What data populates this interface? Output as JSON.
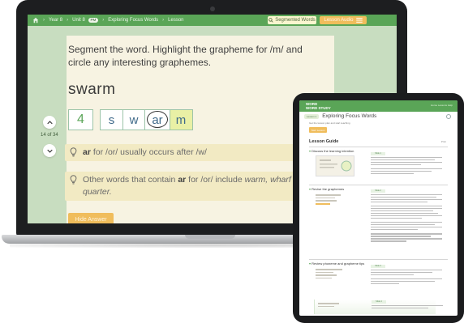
{
  "laptop": {
    "breadcrumb": {
      "items": [
        "Year 8",
        "Unit 8",
        "Exploring Focus Words",
        "Lesson"
      ],
      "unit_badge": "PM"
    },
    "top_pills": {
      "segmented_words": "Segmented Words",
      "lesson_audio": "Lesson Audio"
    },
    "page_count": "14 of 34",
    "instruction": "Segment the word. Highlight the grapheme for /m/ and circle any interesting graphemes.",
    "word": "swarm",
    "phoneme_count": "4",
    "graphemes": [
      {
        "text": "s",
        "circled": false,
        "highlighted": false
      },
      {
        "text": "w",
        "circled": false,
        "highlighted": false
      },
      {
        "text": "ar",
        "circled": true,
        "highlighted": false
      },
      {
        "text": "m",
        "circled": false,
        "highlighted": true
      }
    ],
    "tips": [
      {
        "bold": "ar",
        "text": " for /or/ usually occurs after /w/",
        "italic": ""
      },
      {
        "prefix": "Other words that contain ",
        "bold": "ar",
        "text": " for /or/ include ",
        "italic": "warm, wharf a quarter."
      }
    ],
    "hide_answer_label": "Hide Answer",
    "colors": {
      "accent_green": "#5aa557",
      "accent_orange": "#f0bd5c",
      "panel": "#f7f3e2",
      "tip_bg": "#f2eac3"
    }
  },
  "tablet": {
    "logo_line1": "WORD",
    "logo_line2": "WORD STUDY",
    "header_links": "Home  Lessons  Help",
    "back_label": "Lesson 1",
    "title": "Exploring Focus Words",
    "subtitle": "Get the lesson plan and start teaching",
    "start_button": "Start Lesson",
    "guide_title": "Lesson Guide",
    "print_label": "Print",
    "sections": [
      "Discuss the learning intention",
      "Revise the graphemes",
      "Review phoneme and grapheme tips"
    ],
    "block_labels": [
      "Slide 1",
      "Slide 2",
      "Slide 3",
      "Slide 4"
    ]
  }
}
